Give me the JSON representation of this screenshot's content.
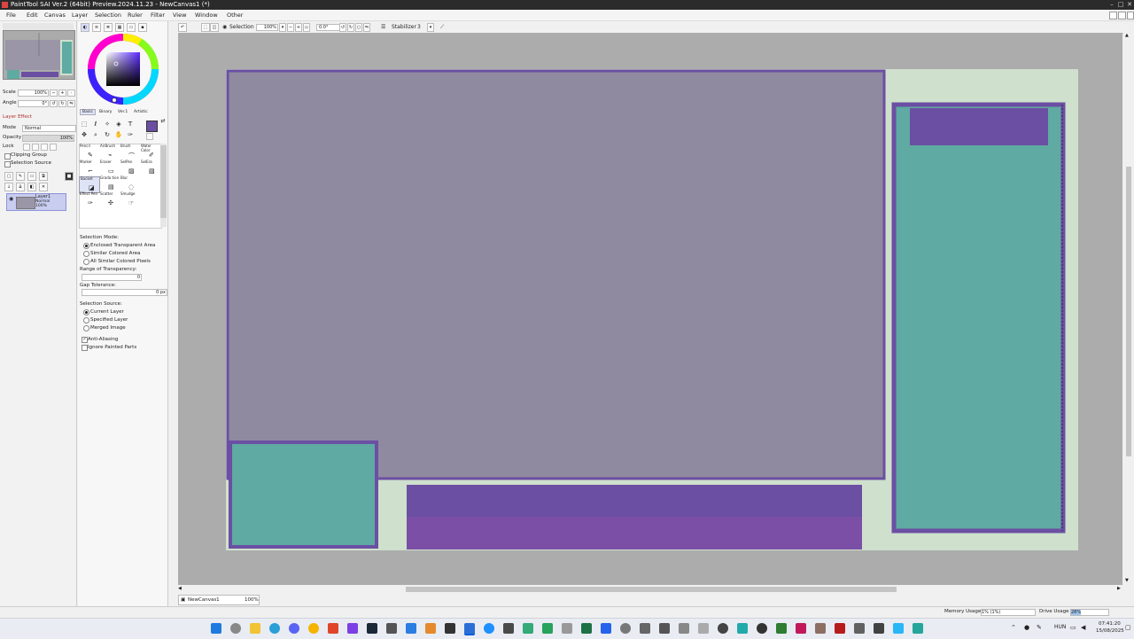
{
  "app": {
    "title": "PaintTool SAI Ver.2 (64bit) Preview.2024.11.23 - NewCanvas1 (*)",
    "window_min": "–",
    "window_max": "□",
    "window_close": "✕"
  },
  "menu": {
    "items": [
      "File",
      "Edit",
      "Canvas",
      "Layer",
      "Selection",
      "Ruler",
      "Filter",
      "View",
      "Window",
      "Other"
    ]
  },
  "toolbar": {
    "selection_label": "Selection",
    "zoom_value": "100%",
    "rotation_value": "0.0°",
    "stabilizer_label": "Stabilizer",
    "stabilizer_value": "3"
  },
  "navigator": {
    "scale_label": "Scale",
    "scale_value": "100%",
    "angle_label": "Angle",
    "angle_value": "0°"
  },
  "layer_panel": {
    "layer_effect": "Layer Effect",
    "mode_label": "Mode",
    "mode_value": "Normal",
    "opacity_label": "Opacity",
    "opacity_value": "100%",
    "lock_label": "Lock",
    "clipping_group": "Clipping Group",
    "selection_source": "Selection Source",
    "layer": {
      "name": "Layer1",
      "mode": "Normal",
      "opacity": "100%"
    }
  },
  "color_tabs": [
    "Basic",
    "Binary",
    "Ver.1",
    "Artistic"
  ],
  "brushes": [
    {
      "label": "Pencil",
      "icon": "✎"
    },
    {
      "label": "AirBrush",
      "icon": "⌁"
    },
    {
      "label": "Brush",
      "icon": "⌒"
    },
    {
      "label": "Water Color",
      "icon": "✐"
    },
    {
      "label": "Marker",
      "icon": "⌐"
    },
    {
      "label": "Eraser",
      "icon": "▭"
    },
    {
      "label": "SelPen",
      "icon": "▨"
    },
    {
      "label": "SelEra",
      "icon": "▧"
    },
    {
      "label": "Bucket",
      "icon": "◪"
    },
    {
      "label": "Grada tion",
      "icon": "▤"
    },
    {
      "label": "Blur",
      "icon": "◌"
    },
    {
      "label": "",
      "icon": ""
    },
    {
      "label": "Effect Pen",
      "icon": "✑"
    },
    {
      "label": "Scatter",
      "icon": "✣"
    },
    {
      "label": "Smudge",
      "icon": "☞"
    },
    {
      "label": "",
      "icon": ""
    }
  ],
  "tool_options": {
    "selection_mode_label": "Selection Mode:",
    "selection_modes": [
      "Enclosed Transparent Area",
      "Similar Colored Area",
      "All Similar Colored Pixels"
    ],
    "range_label": "Range of Transparency:",
    "range_value": "0",
    "gap_label": "Gap Tolerance:",
    "gap_value": "0 px",
    "source_label": "Selection Source:",
    "sources": [
      "Current Layer",
      "Specified Layer",
      "Merged Image"
    ],
    "anti_aliasing": "Anti-Aliasing",
    "ignore_painted": "Ignore Painted Parts"
  },
  "canvas_tab": {
    "name": "NewCanvas1",
    "zoom": "100%"
  },
  "status": {
    "memory_label": "Memory Usage",
    "memory_value": "1% (1%)",
    "drive_label": "Drive Usage",
    "drive_value": "28%"
  },
  "system_tray": {
    "language": "HUN",
    "time": "07:41:20",
    "date": "15/08/2025"
  },
  "colors": {
    "accent_purple": "#6b4fa3",
    "canvas_grey": "#908aa0",
    "teal": "#5faaa2",
    "mint": "#cfe0cd",
    "workspace": "#acacac"
  }
}
